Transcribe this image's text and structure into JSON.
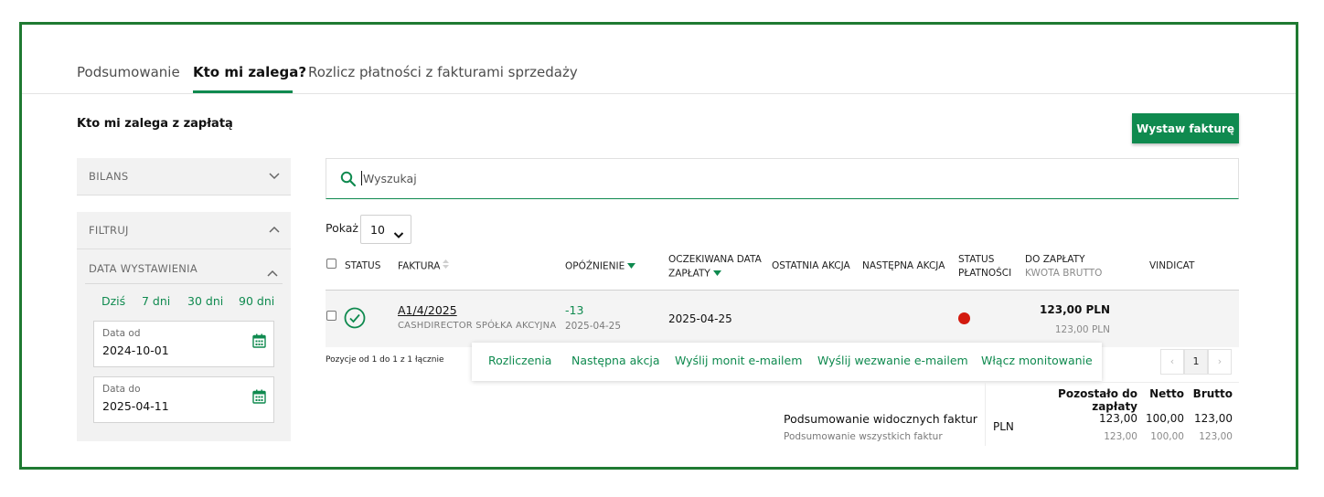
{
  "tabs": [
    {
      "label": "Podsumowanie"
    },
    {
      "label": "Kto mi zalega?"
    },
    {
      "label": "Rozlicz płatności z fakturami sprzedaży"
    }
  ],
  "page_title": "Kto mi zalega z zapłatą",
  "issue_invoice_label": "Wystaw fakturę",
  "sidebar": {
    "balance_label": "BILANS",
    "filter_label": "FILTRUJ",
    "issue_date_label": "DATA WYSTAWIENIA",
    "quick_ranges": [
      "Dziś",
      "7 dni",
      "30 dni",
      "90 dni"
    ],
    "date_from": {
      "label": "Data od",
      "value": "2024-10-01"
    },
    "date_to": {
      "label": "Data do",
      "value": "2025-04-11"
    }
  },
  "search": {
    "placeholder": "Wyszukaj"
  },
  "page_size": {
    "label": "Pokaż",
    "value": "10"
  },
  "table": {
    "headers": {
      "status": "STATUS",
      "invoice": "FAKTURA",
      "delay": "OPÓŹNIENIE",
      "expected_1": "OCZEKIWANA DATA",
      "expected_2": "ZAPŁATY",
      "last_action": "OSTATNIA AKCJA",
      "next_action": "NASTĘPNA AKCJA",
      "pay_status_1": "STATUS",
      "pay_status_2": "PŁATNOŚCI",
      "to_pay": "DO ZAPŁATY",
      "gross": "KWOTA BRUTTO",
      "vindicat": "VINDICAT"
    },
    "rows": [
      {
        "invoice": "A1/4/2025",
        "client": "CASHDIRECTOR SPÓŁKA AKCYJNA",
        "delay": "-13",
        "delay_date": "2025-04-25",
        "expected": "2025-04-25",
        "amount": "123,00  PLN",
        "gross": "123,00 PLN",
        "payment_status_color": "#d31a0e"
      }
    ]
  },
  "positions_text": "Pozycje od 1 do 1 z 1 łącznie",
  "row_actions": [
    "Rozliczenia",
    "Następna akcja",
    "Wyślij monit e-mailem",
    "Wyślij wezwanie e-mailem",
    "Włącz monitowanie"
  ],
  "pagination": {
    "prev": "‹",
    "current": "1",
    "next": "›"
  },
  "summary": {
    "headers": {
      "remaining": "Pozostało do zapłaty",
      "net": "Netto",
      "gross": "Brutto"
    },
    "visible_label": "Podsumowanie widocznych faktur",
    "all_label": "Podsumowanie wszystkich faktur",
    "currency": "PLN",
    "visible": {
      "remaining": "123,00",
      "net": "100,00",
      "gross": "123,00"
    },
    "all": {
      "remaining": "123,00",
      "net": "100,00",
      "gross": "123,00"
    }
  },
  "colors": {
    "accent": "#0f8a4f",
    "frame": "#1f7a32",
    "error": "#d31a0e"
  }
}
